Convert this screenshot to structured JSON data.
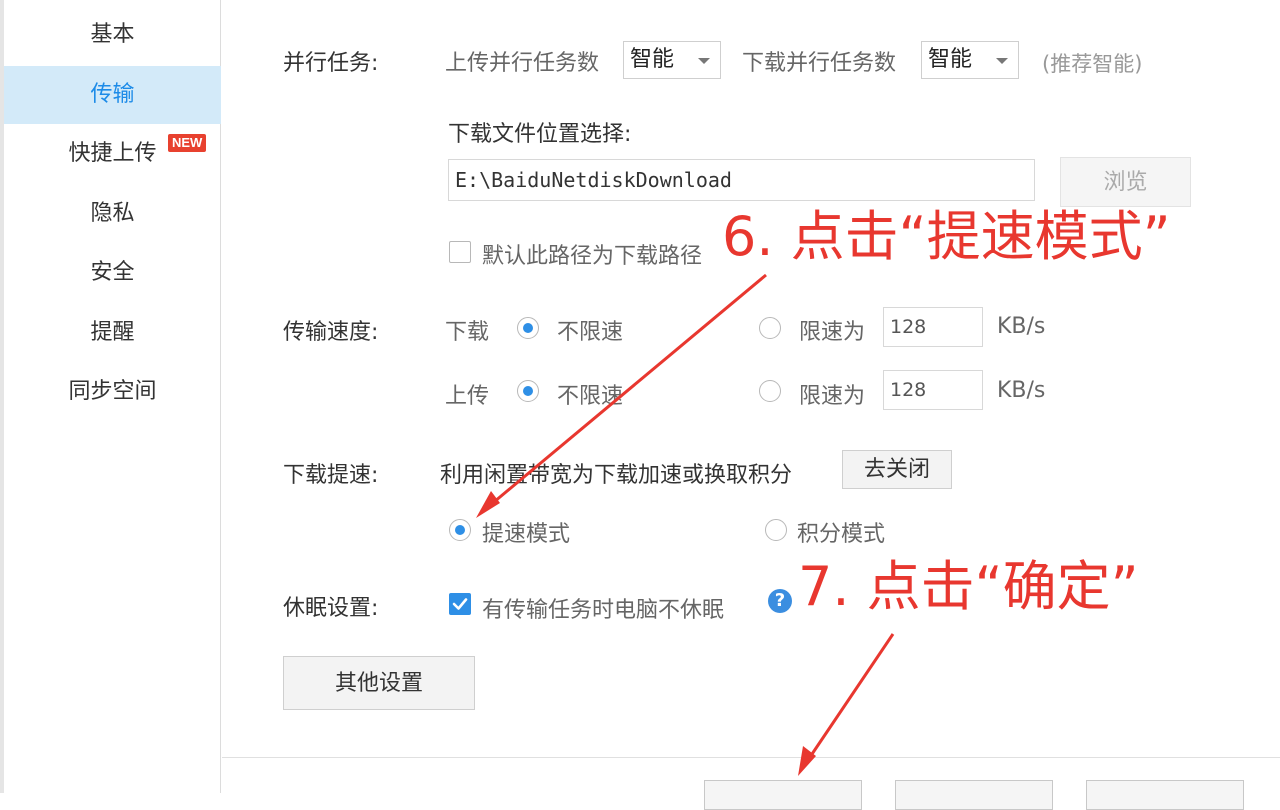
{
  "sidebar": {
    "items": [
      {
        "label": "基本",
        "active": false
      },
      {
        "label": "传输",
        "active": true
      },
      {
        "label": "快捷上传",
        "active": false
      },
      {
        "label": "隐私",
        "active": false
      },
      {
        "label": "安全",
        "active": false
      },
      {
        "label": "提醒",
        "active": false
      },
      {
        "label": "同步空间",
        "active": false
      }
    ],
    "new_badge": "NEW"
  },
  "parallel": {
    "label": "并行任务:",
    "upload_label": "上传并行任务数",
    "upload_value": "智能",
    "download_label": "下载并行任务数",
    "download_value": "智能",
    "hint": "(推荐智能)"
  },
  "download_location": {
    "label": "下载文件位置选择:",
    "path": "E:\\BaiduNetdiskDownload",
    "browse_label": "浏览",
    "default_checkbox_label": "默认此路径为下载路径"
  },
  "speed": {
    "label": "传输速度:",
    "download_label": "下载",
    "upload_label": "上传",
    "unlimited_label": "不限速",
    "limit_label": "限速为",
    "download_limit_value": "128",
    "upload_limit_value": "128",
    "unit": "KB/s"
  },
  "boost": {
    "label": "下载提速:",
    "description": "利用闲置带宽为下载加速或换取积分",
    "close_label": "去关闭",
    "fast_mode_label": "提速模式",
    "points_mode_label": "积分模式"
  },
  "sleep": {
    "label": "休眠设置:",
    "checkbox_label": "有传输任务时电脑不休眠",
    "help_icon": "?"
  },
  "other_settings_label": "其他设置",
  "annotations": {
    "step6": "6. 点击“提速模式”",
    "step7": "7. 点击“确定”",
    "color": "#e8372f"
  },
  "colors": {
    "accent": "#2e8fe6",
    "sidebar_active_bg": "#d3eaf9",
    "badge": "#e8412f"
  }
}
